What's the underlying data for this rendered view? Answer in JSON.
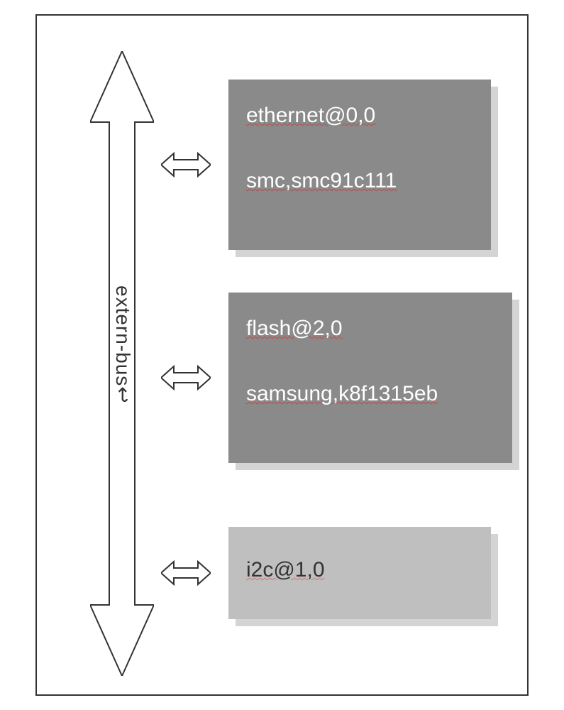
{
  "bus_label": "extern-bus",
  "boxes": [
    {
      "line1": "ethernet@0,0",
      "line2": "smc,smc91c111"
    },
    {
      "line1": "flash@2,0",
      "line2": "samsung,k8f1315eb"
    },
    {
      "line1": "i2c@1,0",
      "line2": ""
    }
  ]
}
